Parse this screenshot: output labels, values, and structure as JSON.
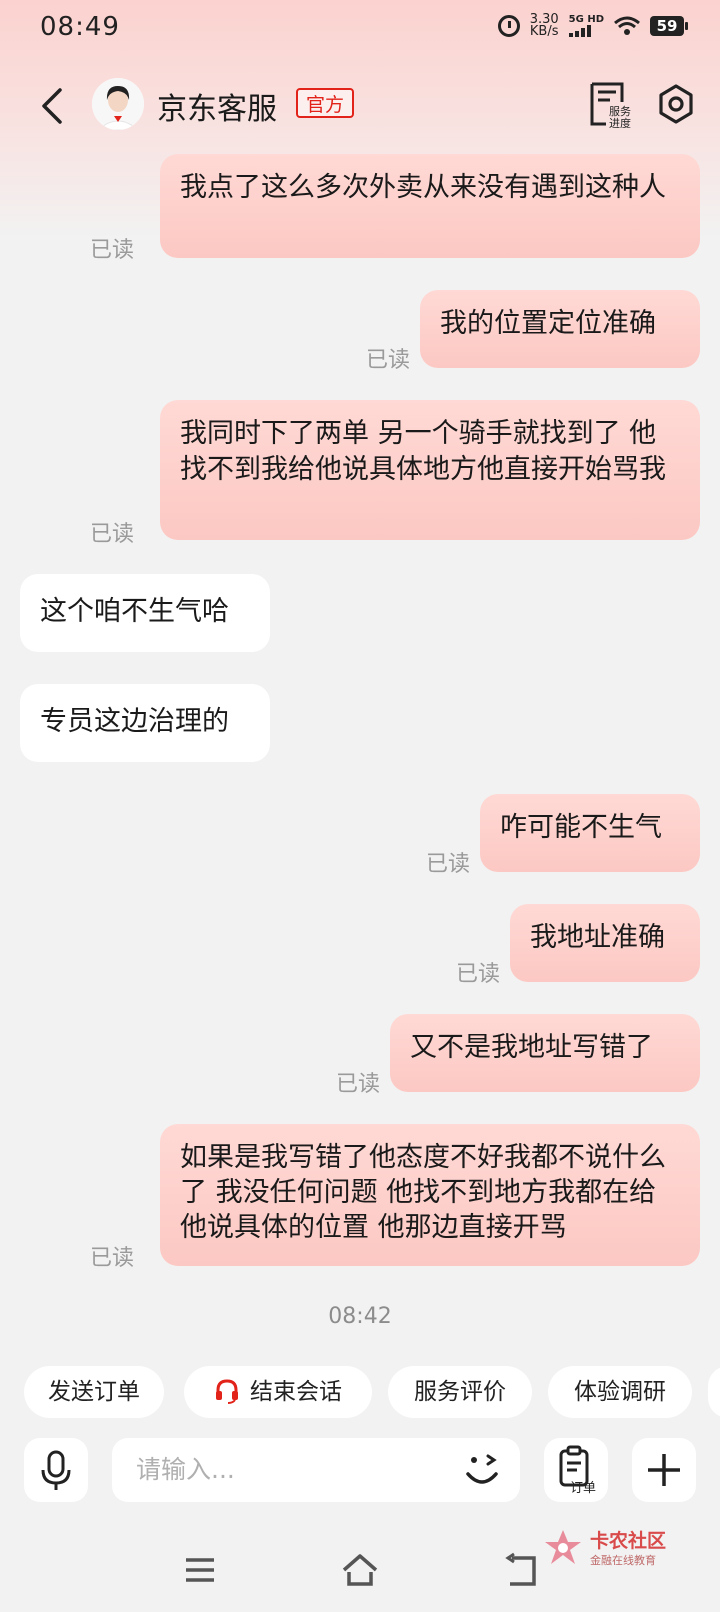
{
  "status_bar": {
    "time": "08:49",
    "speed_value": "3.30",
    "speed_unit": "KB/s",
    "network": "5G HD",
    "battery": "59"
  },
  "header": {
    "title": "京东客服",
    "badge": "官方",
    "progress_label_line1": "服务",
    "progress_label_line2": "进度"
  },
  "messages": [
    {
      "side": "out",
      "text": "我点了这么多次外卖从来没有遇到这种人",
      "read": "已读"
    },
    {
      "side": "out",
      "text": "我的位置定位准确",
      "read": "已读"
    },
    {
      "side": "out",
      "text": "我同时下了两单 另一个骑手就找到了 他找不到我给他说具体地方他直接开始骂我",
      "read": "已读"
    },
    {
      "side": "in",
      "text": "这个咱不生气哈"
    },
    {
      "side": "in",
      "text": "专员这边治理的"
    },
    {
      "side": "out",
      "text": "咋可能不生气",
      "read": "已读"
    },
    {
      "side": "out",
      "text": "我地址准确",
      "read": "已读"
    },
    {
      "side": "out",
      "text": "又不是我地址写错了",
      "read": "已读"
    },
    {
      "side": "out",
      "text": "如果是我写错了他态度不好我都不说什么了 我没任何问题 他找不到地方我都在给他说具体的位置 他那边直接开骂",
      "read": "已读"
    }
  ],
  "timestamp": "08:42",
  "quick_actions": [
    "发送订单",
    "结束会话",
    "服务评价",
    "体验调研"
  ],
  "input": {
    "placeholder": "请输入...",
    "order_label": "订单"
  },
  "watermark": {
    "title": "卡农社区",
    "subtitle": "金融在线教育"
  },
  "colors": {
    "brand_red": "#e2231a",
    "outgoing_bubble": "#ffd7d3",
    "incoming_bubble": "#ffffff",
    "background": "#f2f2f2"
  }
}
